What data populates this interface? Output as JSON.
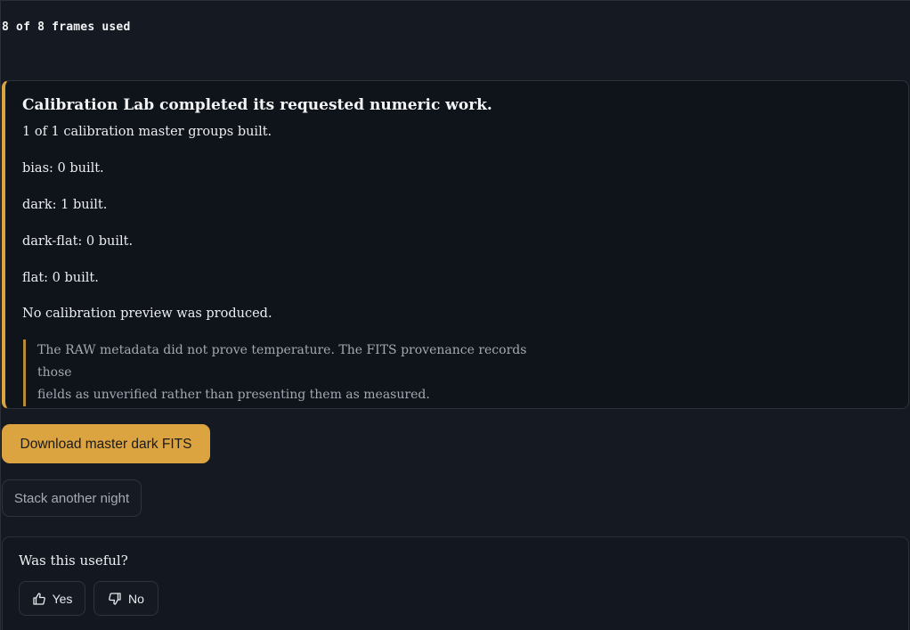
{
  "status": {
    "frames_used": "8 of 8 frames used"
  },
  "result": {
    "title": "Calibration Lab completed its requested numeric work.",
    "lines": [
      "1 of 1 calibration master groups built.",
      "bias: 0 built.",
      "dark: 1 built.",
      "dark-flat: 0 built.",
      "flat: 0 built.",
      "No calibration preview was produced."
    ],
    "note_line1": "The RAW metadata did not prove temperature. The FITS provenance records those",
    "note_line2": "fields as unverified rather than presenting them as measured."
  },
  "actions": {
    "download_label": "Download master dark FITS",
    "stack_label": "Stack another night"
  },
  "feedback": {
    "question": "Was this useful?",
    "yes_label": "Yes",
    "no_label": "No",
    "yes_icon": "thumbs-up-icon",
    "no_icon": "thumbs-down-icon"
  },
  "colors": {
    "accent": "#dba441",
    "background": "#151a22",
    "card": "#0f131a"
  }
}
